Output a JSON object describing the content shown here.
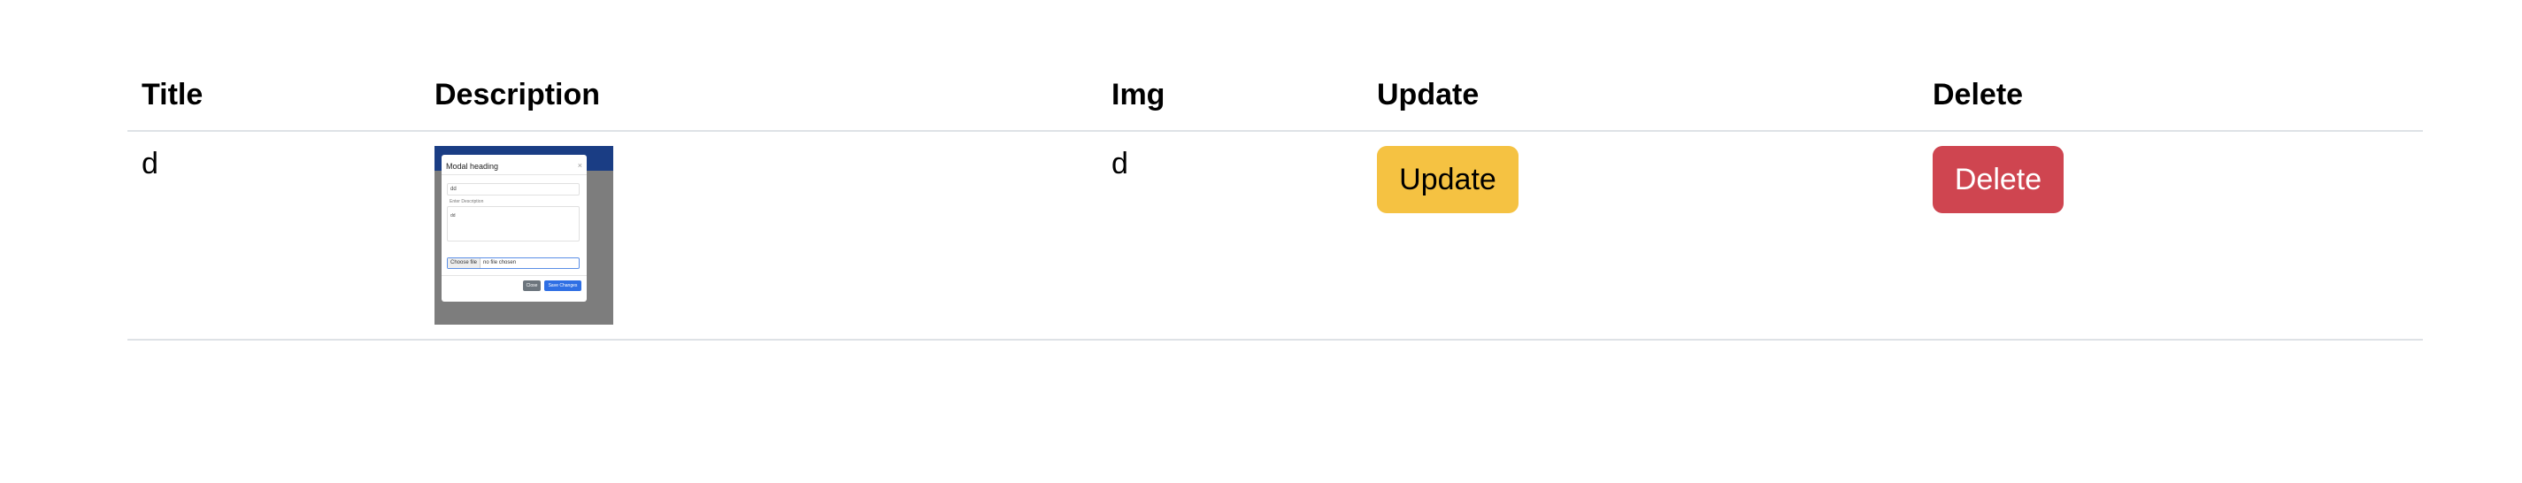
{
  "table": {
    "headers": {
      "title": "Title",
      "description": "Description",
      "img": "Img",
      "update": "Update",
      "delete": "Delete"
    },
    "rows": [
      {
        "title": "d",
        "img": "d",
        "update_label": "Update",
        "delete_label": "Delete"
      }
    ]
  },
  "thumbnail": {
    "modal_heading": "Modal heading",
    "close_symbol": "×",
    "input_value": "dd",
    "textarea_label": "Enter Description",
    "textarea_value": "dd",
    "file_button": "Choose file",
    "file_status": "no file chosen",
    "close_button": "Close",
    "save_button": "Save Changes"
  },
  "colors": {
    "update_button": "#f5c242",
    "delete_button": "#cf4550",
    "table_border": "#dee2e6"
  }
}
